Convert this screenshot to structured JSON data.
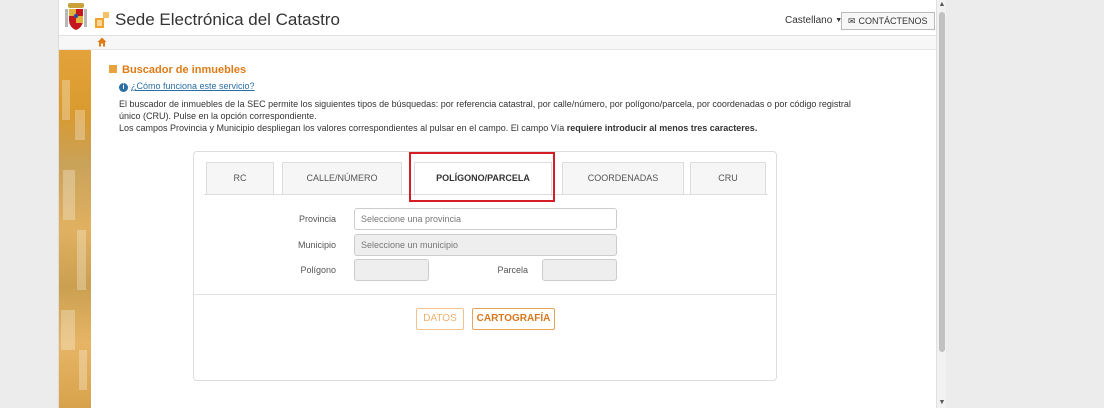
{
  "header": {
    "site_title": "Sede Electrónica del Catastro",
    "language": "Castellano",
    "contact_label": "CONTÁCTENOS"
  },
  "icons": {
    "coat_of_arms": "spain-coat-of-arms-icon",
    "logo": "catastro-logo-icon",
    "home": "home-icon",
    "info": "info-icon",
    "mail": "envelope-icon",
    "dropdown": "caret-down-icon"
  },
  "colors": {
    "accent": "#e07b16",
    "link": "#2a6ea6",
    "highlight": "#d51d24",
    "strip": "#e98a1a"
  },
  "content": {
    "section_title": "Buscador de inmuebles",
    "help_link": "¿Cómo funciona este servicio?",
    "description_1": "El buscador de inmuebles de la SEC permite los siguientes tipos de búsquedas: por referencia catastral, por calle/número, por polígono/parcela, por coordenadas o por código registral único (CRU). Pulse en la opción correspondiente.",
    "description_2_start": "Los campos Provincia y Municipio despliegan los valores correspondientes al pulsar en el campo. El campo Vía ",
    "description_2_bold": "requiere introducir al menos tres caracteres."
  },
  "search": {
    "tabs": [
      {
        "label": "RC",
        "active": false
      },
      {
        "label": "CALLE/NÚMERO",
        "active": false
      },
      {
        "label": "POLÍGONO/PARCELA",
        "active": true
      },
      {
        "label": "COORDENADAS",
        "active": false
      },
      {
        "label": "CRU",
        "active": false
      }
    ],
    "provincia": {
      "label": "Provincia",
      "placeholder": "Seleccione una provincia",
      "value": ""
    },
    "municipio": {
      "label": "Municipio",
      "placeholder": "Seleccione un municipio",
      "value": ""
    },
    "poligono": {
      "label": "Polígono",
      "value": ""
    },
    "parcela": {
      "label": "Parcela",
      "value": ""
    },
    "datos_label": "DATOS",
    "cartografia_label": "CARTOGRAFÍA"
  }
}
